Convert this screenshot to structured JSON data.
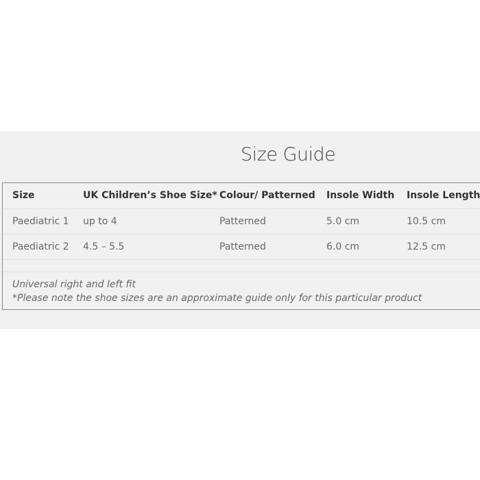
{
  "title": "Size Guide",
  "table": {
    "headers": [
      "Size",
      "UK Children’s Shoe Size*",
      "Colour/ Patterned",
      "Insole Width",
      "Insole Length"
    ],
    "rows": [
      [
        "Paediatric 1",
        "up to 4",
        "Patterned",
        "5.0 cm",
        "10.5 cm"
      ],
      [
        "Paediatric 2",
        "4.5 – 5.5",
        "Patterned",
        "6.0 cm",
        "12.5 cm"
      ]
    ]
  },
  "notes": [
    "Universal right and left fit",
    "*Please note the shoe sizes are an approximate guide only for this particular product"
  ]
}
